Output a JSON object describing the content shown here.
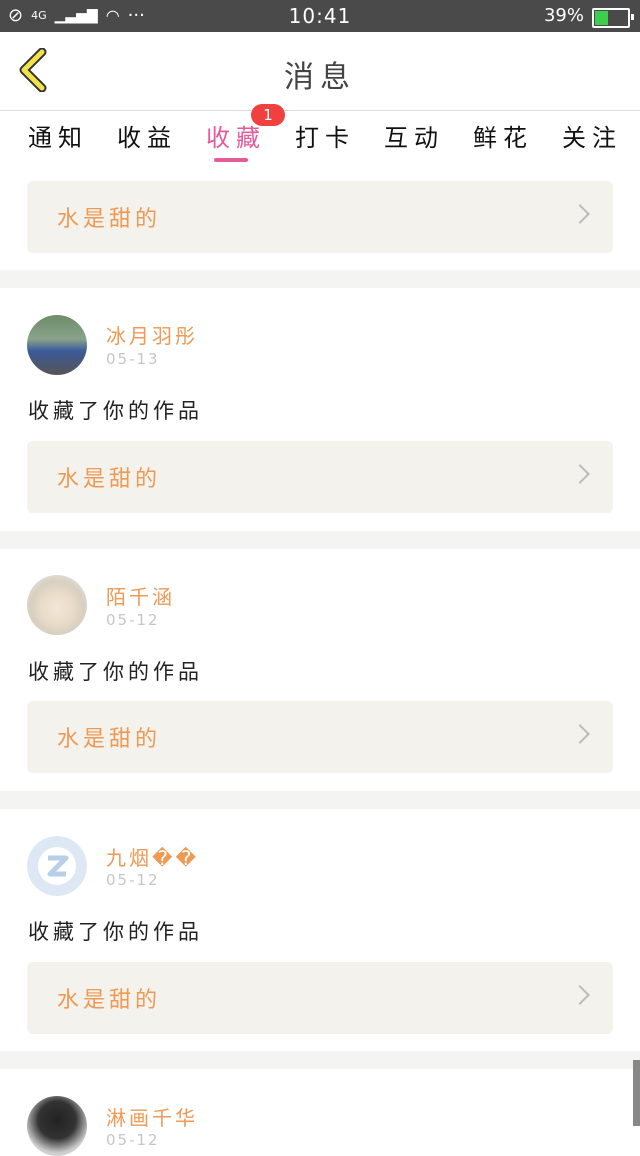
{
  "status_bar": {
    "time": "10:41",
    "battery": "39%",
    "battery_level": 0.39,
    "signal": "4G"
  },
  "header": {
    "title": "消息"
  },
  "tabs": [
    {
      "label": "通知"
    },
    {
      "label": "收益"
    },
    {
      "label": "收藏",
      "active": true,
      "badge": "1"
    },
    {
      "label": "打卡"
    },
    {
      "label": "互动"
    },
    {
      "label": "鲜花"
    },
    {
      "label": "关注"
    }
  ],
  "top_work": {
    "title": "水是甜的"
  },
  "items": [
    {
      "user": "冰月羽彤",
      "date": "05-13",
      "message": "收藏了你的作品",
      "work": "水是甜的"
    },
    {
      "user": "陌千涵",
      "date": "05-12",
      "message": "收藏了你的作品",
      "work": "水是甜的"
    },
    {
      "user": "九烟��",
      "date": "05-12",
      "message": "收藏了你的作品",
      "work": "水是甜的"
    },
    {
      "user": "淋画千华",
      "date": "05-12"
    }
  ],
  "colors": {
    "accent": "#e45a9a",
    "name": "#ee9a55",
    "badge": "#f04040",
    "card_bg": "#f3f2ec"
  }
}
